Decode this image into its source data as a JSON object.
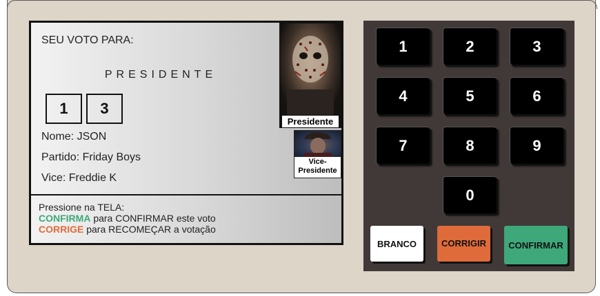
{
  "screen": {
    "heading": "SEU VOTO PARA:",
    "cargo": "PRESIDENTE",
    "digits": [
      "1",
      "3"
    ],
    "nome": "Nome: JSON",
    "partido": "Partido: Friday Boys",
    "vice": "Vice: Freddie K",
    "photo_president_caption": "Presidente",
    "photo_vice_caption_line1": "Vice-",
    "photo_vice_caption_line2": "Presidente",
    "instructions": {
      "line1": "Pressione na TELA:",
      "confirma_word": "CONFIRMA",
      "confirma_rest": " para CONFIRMAR este voto",
      "corrige_word": "CORRIGE",
      "corrige_rest": " para RECOMEÇAR a votação"
    }
  },
  "keypad": {
    "keys": [
      "1",
      "2",
      "3",
      "4",
      "5",
      "6",
      "7",
      "8",
      "9",
      "0"
    ],
    "branco": "BRANCO",
    "corrigir": "CORRIGIR",
    "confirmar": "CONFIRMAR"
  },
  "colors": {
    "confirm": "#3ea87b",
    "correct": "#e06b3a",
    "blank": "#ffffff",
    "keypad_bg": "#413938",
    "body_bg": "#dcd5c8"
  }
}
